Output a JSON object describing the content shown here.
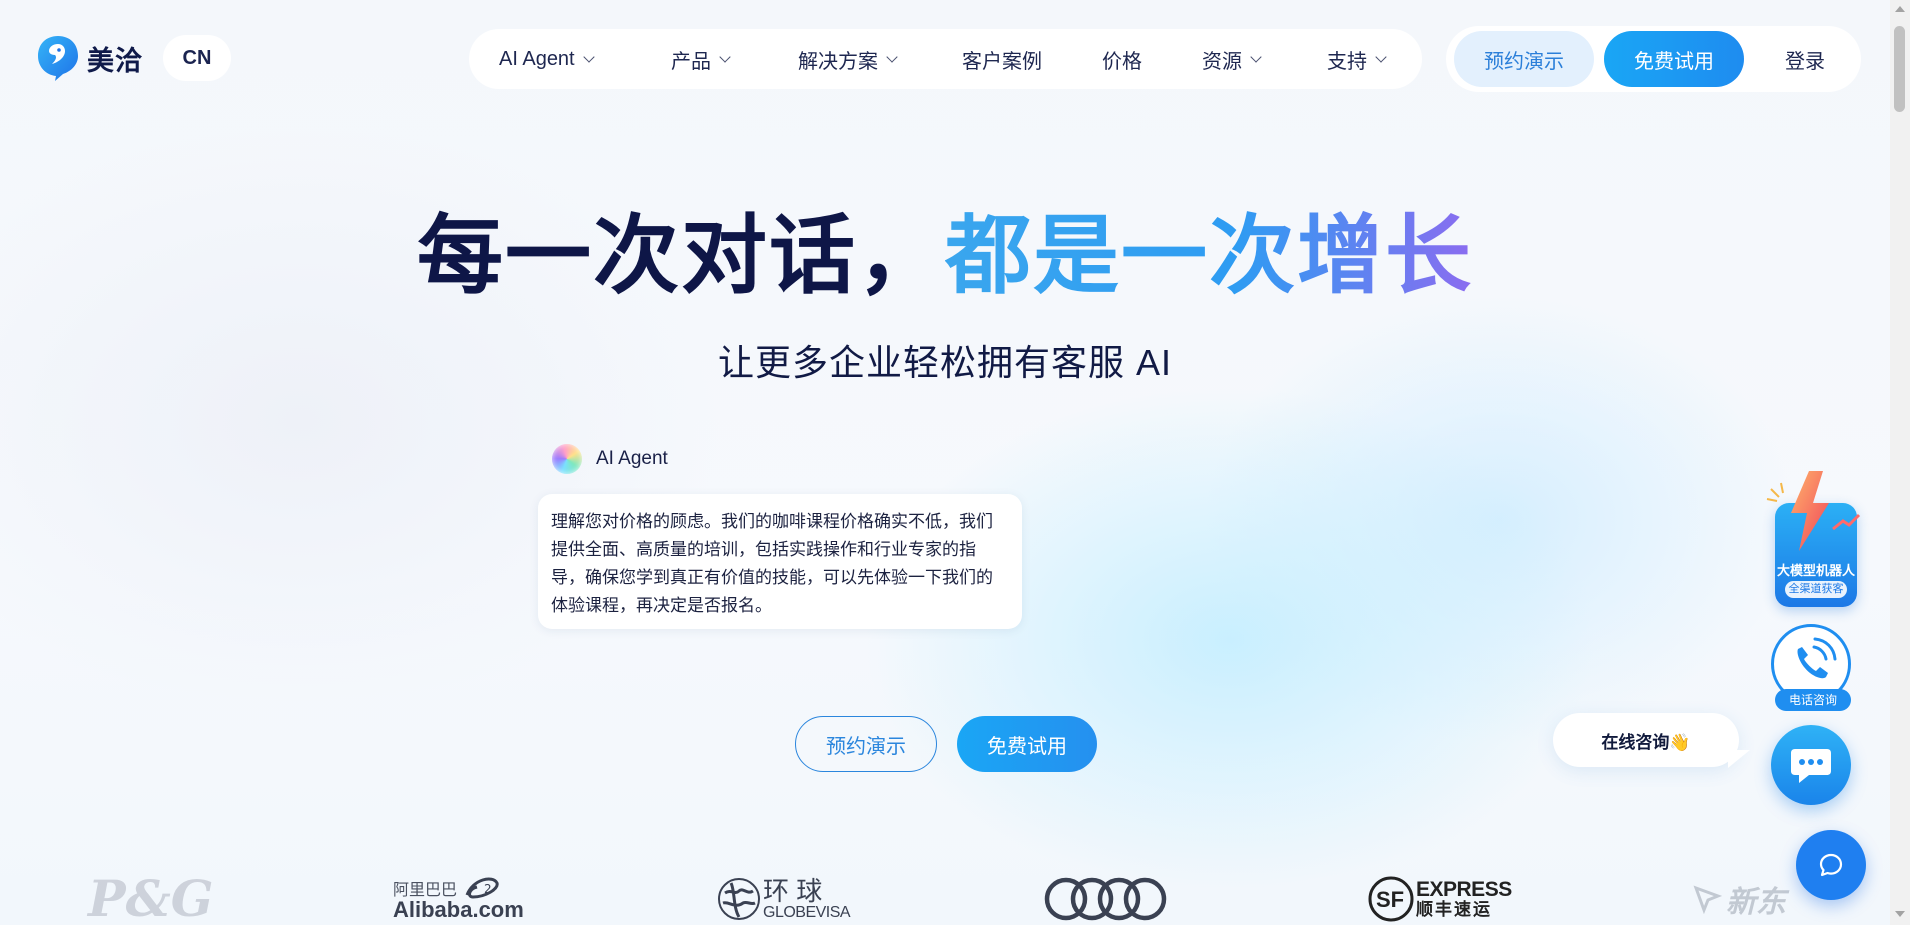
{
  "brand": {
    "name": "美洽",
    "lang": "CN"
  },
  "nav": {
    "items": [
      {
        "label": "AI Agent",
        "dropdown": true
      },
      {
        "label": "产品",
        "dropdown": true
      },
      {
        "label": "解决方案",
        "dropdown": true
      },
      {
        "label": "客户案例",
        "dropdown": false
      },
      {
        "label": "价格",
        "dropdown": false
      },
      {
        "label": "资源",
        "dropdown": true
      },
      {
        "label": "支持",
        "dropdown": true
      }
    ],
    "demo_label": "预约演示",
    "trial_label": "免费试用",
    "login_label": "登录"
  },
  "hero": {
    "headline_dark": "每一次对话，",
    "headline_gradient": "都是一次增长",
    "subheadline": "让更多企业轻松拥有客服 AI",
    "agent_name": "AI Agent",
    "message": "理解您对价格的顾虑。我们的咖啡课程价格确实不低，我们提供全面、高质量的培训，包括实践操作和行业专家的指导，确保您学到真正有价值的技能，可以先体验一下我们的体验课程，再决定是否报名。",
    "demo_label": "预约演示",
    "trial_label": "免费试用"
  },
  "logos": {
    "pg": "P&G",
    "alibaba_cn": "阿里巴巴",
    "alibaba_en": "Alibaba.com",
    "globevisa_cn": "环 球",
    "globevisa_en": "GLOBEVISA",
    "sf_en": "EXPRESS",
    "sf_cn": "顺丰速运",
    "last_partial": "新东"
  },
  "widgets": {
    "robot_title": "大模型机器人",
    "robot_sub": "全渠道获客",
    "phone_label": "电话咨询",
    "consult_label": "在线咨询👋"
  },
  "colors": {
    "primary": "#1f8ef0",
    "headline_dark": "#0e1647",
    "gradient_start": "#3aa6ee",
    "gradient_end": "#8b6cf0"
  }
}
